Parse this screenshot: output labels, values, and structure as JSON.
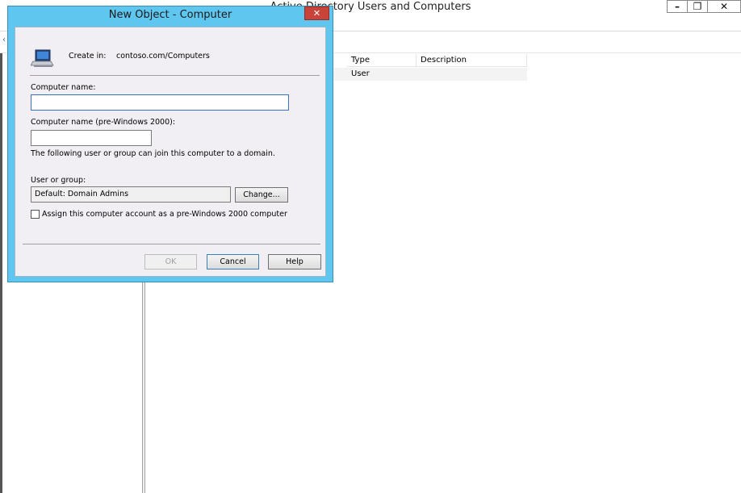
{
  "main_window": {
    "title": "Active Directory Users and Computers",
    "minimize_glyph": "–",
    "restore_glyph": "❐",
    "close_glyph": "✕",
    "list": {
      "columns": [
        "Type",
        "Description"
      ],
      "rows": [
        {
          "type": "User",
          "description": ""
        }
      ]
    }
  },
  "dialog": {
    "title": "New Object - Computer",
    "close_glyph": "✕",
    "create_in_label": "Create in:",
    "create_in_value": "contoso.com/Computers",
    "computer_name_label": "Computer name:",
    "computer_name_value": "",
    "pre2000_label": "Computer name (pre-Windows 2000):",
    "pre2000_value": "",
    "join_text": "The following user or group can join this computer to a domain.",
    "user_group_label": "User or group:",
    "user_group_value": "Default: Domain Admins",
    "change_button": "Change...",
    "assign_checkbox_label": "Assign this computer account as a pre-Windows 2000 computer",
    "assign_checked": false,
    "ok_button": "OK",
    "cancel_button": "Cancel",
    "help_button": "Help"
  },
  "icons": {
    "dialog_icon": "computer-icon"
  },
  "colors": {
    "dialog_frame": "#5fc6f0",
    "close_button": "#c8443a",
    "dialog_body": "#f1eff4"
  }
}
